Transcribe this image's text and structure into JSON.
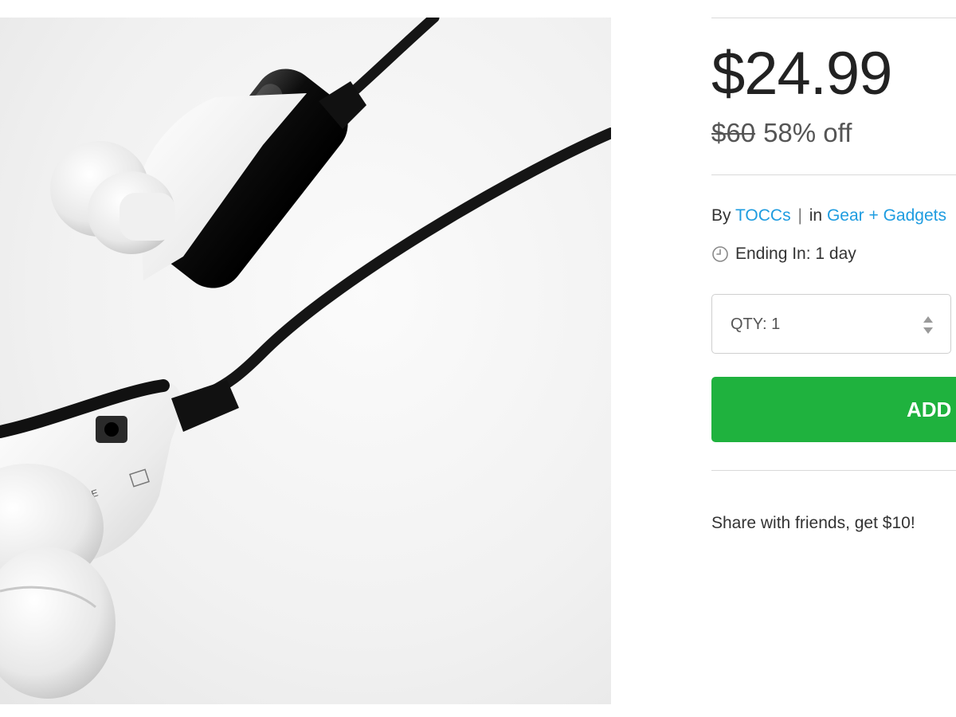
{
  "product": {
    "image_alt": "TOCCs Bluetooth earbuds"
  },
  "pricing": {
    "price": "$24.99",
    "original_price": "$60",
    "discount": "58% off"
  },
  "vendor": {
    "by_label": "By",
    "name": "TOCCs",
    "separator": "|",
    "in_label": "in",
    "category": "Gear + Gadgets"
  },
  "deal": {
    "ending_label": "Ending In: 1 day",
    "clock_icon": "clock-icon"
  },
  "quantity": {
    "label": "QTY: 1",
    "stepper_icon": "up-down-stepper-icon"
  },
  "cart": {
    "add_label": "ADD"
  },
  "share": {
    "text": "Share with friends, get $10!"
  },
  "colors": {
    "accent_green": "#1fb23e",
    "link_blue": "#1e9ce0"
  }
}
